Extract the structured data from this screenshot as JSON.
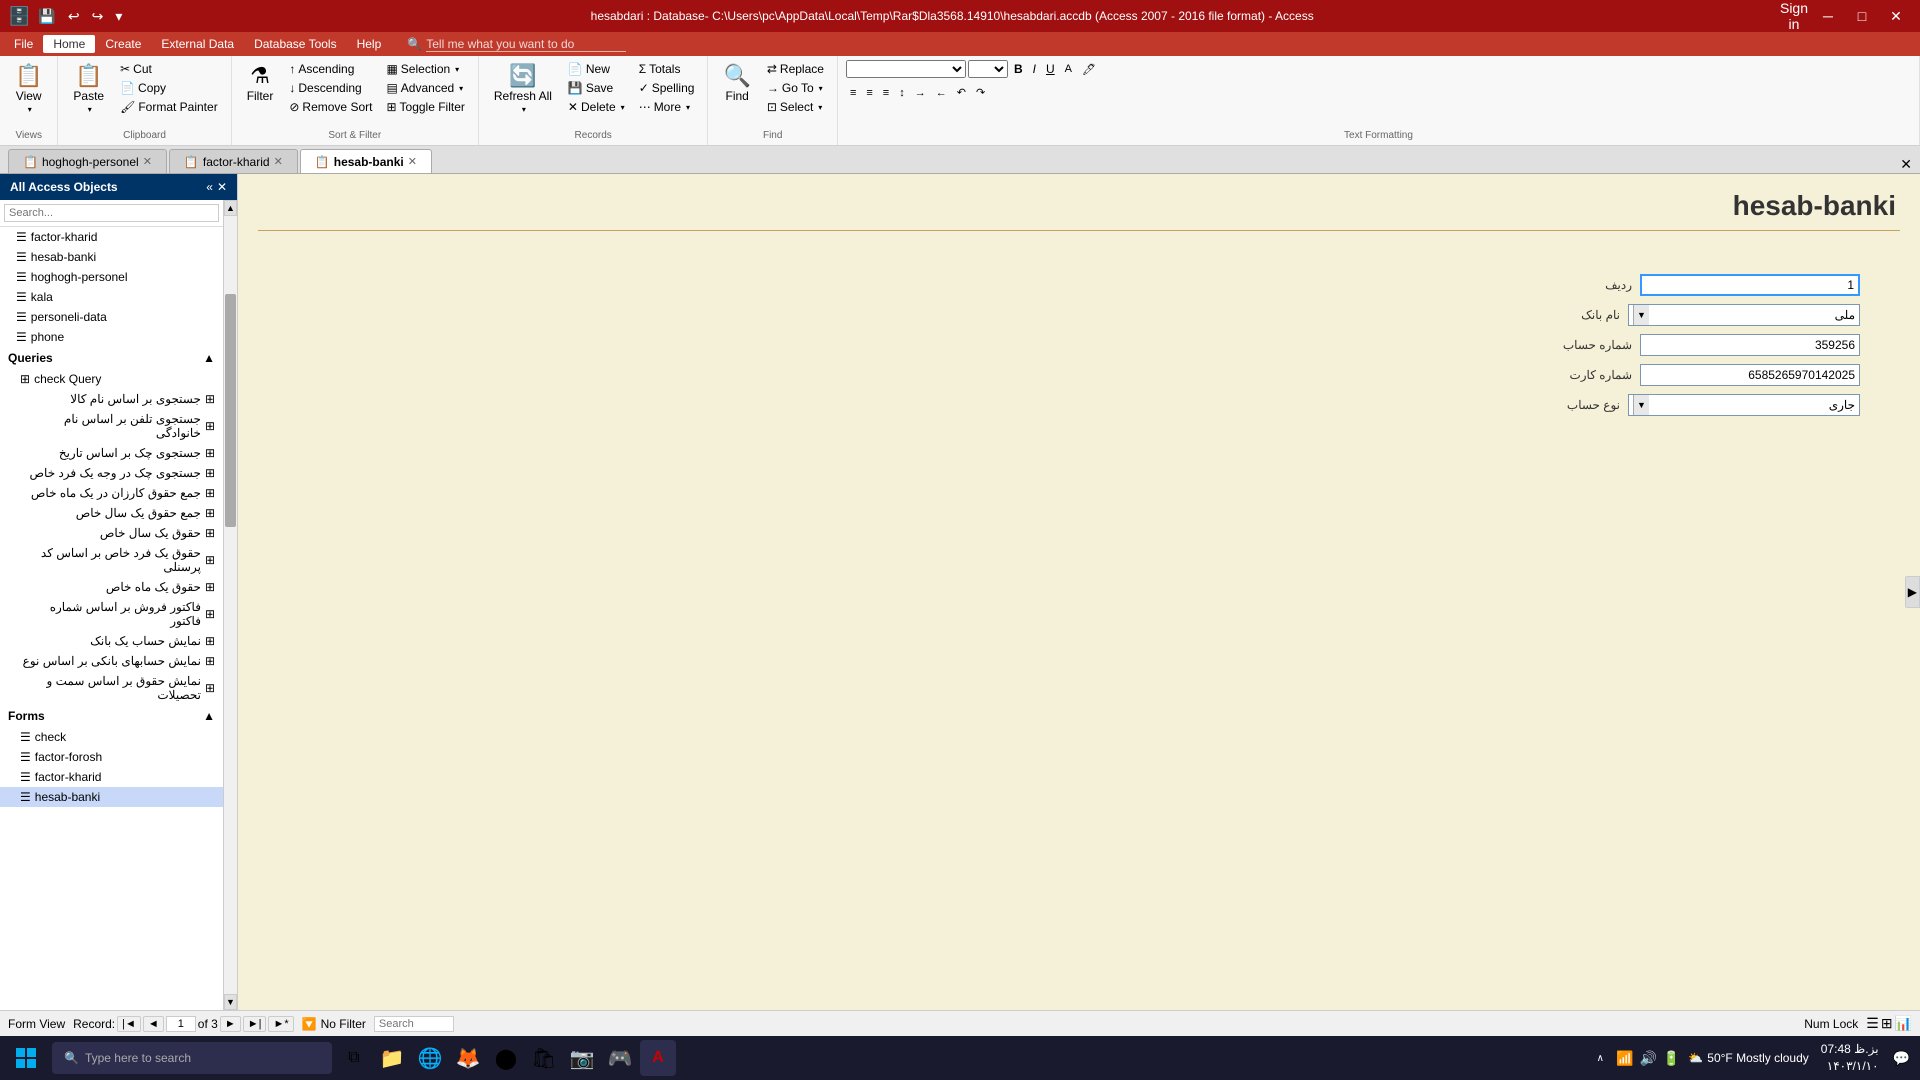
{
  "titleBar": {
    "title": "hesabdari : Database- C:\\Users\\pc\\AppData\\Local\\Temp\\Rar$Dla3568.14910\\hesabdari.accdb (Access 2007 - 2016 file format) - Access",
    "signIn": "Sign in",
    "windowControls": {
      "minimize": "─",
      "maximize": "□",
      "close": "✕"
    },
    "quickAccess": {
      "save": "💾",
      "undo": "↩",
      "redo": "↪",
      "dropdown": "▾"
    }
  },
  "menuBar": {
    "items": [
      "File",
      "Home",
      "Create",
      "External Data",
      "Database Tools",
      "Help"
    ],
    "activeItem": "Home",
    "tellMe": "Tell me what you want to do"
  },
  "ribbon": {
    "groups": {
      "views": {
        "label": "Views",
        "view": "View"
      },
      "clipboard": {
        "label": "Clipboard",
        "paste": "Paste",
        "cut": "Cut",
        "copy": "Copy",
        "formatPainter": "Format Painter"
      },
      "sortFilter": {
        "label": "Sort & Filter",
        "filter": "Filter",
        "ascending": "Ascending",
        "descending": "Descending",
        "removeSort": "Remove Sort",
        "selection": "Selection",
        "advanced": "Advanced",
        "toggleFilter": "Toggle Filter"
      },
      "records": {
        "label": "Records",
        "new": "New",
        "save": "Save",
        "delete": "Delete",
        "totals": "Totals",
        "spelling": "Spelling",
        "more": "More",
        "refreshAll": "Refresh All"
      },
      "find": {
        "label": "Find",
        "find": "Find",
        "replace": "Replace",
        "goTo": "Go To",
        "select": "Select"
      },
      "textFormatting": {
        "label": "Text Formatting"
      }
    }
  },
  "tabs": [
    {
      "label": "hoghogh-personel",
      "icon": "📋",
      "active": false,
      "closeable": true
    },
    {
      "label": "factor-kharid",
      "icon": "📋",
      "active": false,
      "closeable": true
    },
    {
      "label": "hesab-banki",
      "icon": "📋",
      "active": true,
      "closeable": true
    }
  ],
  "sidebar": {
    "header": "All Access Objects",
    "collapseIcon": "«",
    "sections": {
      "tables": {
        "items": [
          {
            "label": "factor-kharid",
            "icon": "☰"
          },
          {
            "label": "hesab-banki",
            "icon": "☰"
          },
          {
            "label": "hoghogh-personel",
            "icon": "☰"
          },
          {
            "label": "kala",
            "icon": "☰"
          },
          {
            "label": "personeli-data",
            "icon": "☰"
          },
          {
            "label": "phone",
            "icon": "☰"
          }
        ]
      },
      "queries": {
        "label": "Queries",
        "items": [
          {
            "label": "check Query",
            "icon": "⊞"
          },
          {
            "label": "جستجوی بر اساس نام کالا",
            "icon": "⊞"
          },
          {
            "label": "جستجوی تلفن بر اساس نام خانوادگی",
            "icon": "⊞"
          },
          {
            "label": "جستجوی چک بر اساس تاریخ",
            "icon": "⊞"
          },
          {
            "label": "جستجوی چک در وجه یک فرد خاص",
            "icon": "⊞"
          },
          {
            "label": "جمع حقوق کارزان در یک ماه خاص",
            "icon": "⊞"
          },
          {
            "label": "جمع حقوق یک سال خاص",
            "icon": "⊞"
          },
          {
            "label": "حقوق یک سال خاص",
            "icon": "⊞"
          },
          {
            "label": "حقوق یک فرد خاص بر اساس کد پرسنلی",
            "icon": "⊞"
          },
          {
            "label": "حقوق یک ماه خاص",
            "icon": "⊞"
          },
          {
            "label": "فاکتور فروش بر اساس شماره فاکتور",
            "icon": "⊞"
          },
          {
            "label": "نمایش حساب یک بانک",
            "icon": "⊞"
          },
          {
            "label": "نمایش حسابهای بانکی بر اساس نوع",
            "icon": "⊞"
          },
          {
            "label": "نمایش حقوق بر اساس سمت و تحصیلات",
            "icon": "⊞"
          }
        ]
      },
      "forms": {
        "label": "Forms",
        "items": [
          {
            "label": "check",
            "icon": "☰"
          },
          {
            "label": "factor-forosh",
            "icon": "☰"
          },
          {
            "label": "factor-kharid",
            "icon": "☰"
          },
          {
            "label": "hesab-banki",
            "icon": "☰",
            "active": true
          }
        ]
      }
    }
  },
  "form": {
    "title": "hesab-banki",
    "fields": [
      {
        "label": "ردیف",
        "type": "input",
        "value": "1"
      },
      {
        "label": "نام بانک",
        "type": "select",
        "value": "ملی"
      },
      {
        "label": "شماره حساب",
        "type": "input",
        "value": "359256"
      },
      {
        "label": "شماره کارت",
        "type": "input",
        "value": "6585265970142025"
      },
      {
        "label": "نوع حساب",
        "type": "select",
        "value": "جاری"
      }
    ]
  },
  "statusBar": {
    "recordLabel": "Record:",
    "first": "◄",
    "prev": "◄",
    "current": "1",
    "of": "of",
    "total": "3",
    "next": "►",
    "last": "►",
    "new": "►|",
    "noFilter": "No Filter",
    "search": "Search",
    "viewMode": "Form View",
    "numLock": "Num Lock",
    "viewIcons": [
      "☰",
      "⊞",
      "📊"
    ]
  },
  "taskbar": {
    "search_placeholder": "Type here to search",
    "apps": [
      "🪟",
      "🔍",
      "📋",
      "📁",
      "💬",
      "📸",
      "🦊",
      "🌐",
      "🎮",
      "🔧"
    ],
    "time": "07:48 بز.ظ",
    "date": "۱۴۰۳/۱/۱۰",
    "weather": "50°F  Mostly cloudy"
  }
}
